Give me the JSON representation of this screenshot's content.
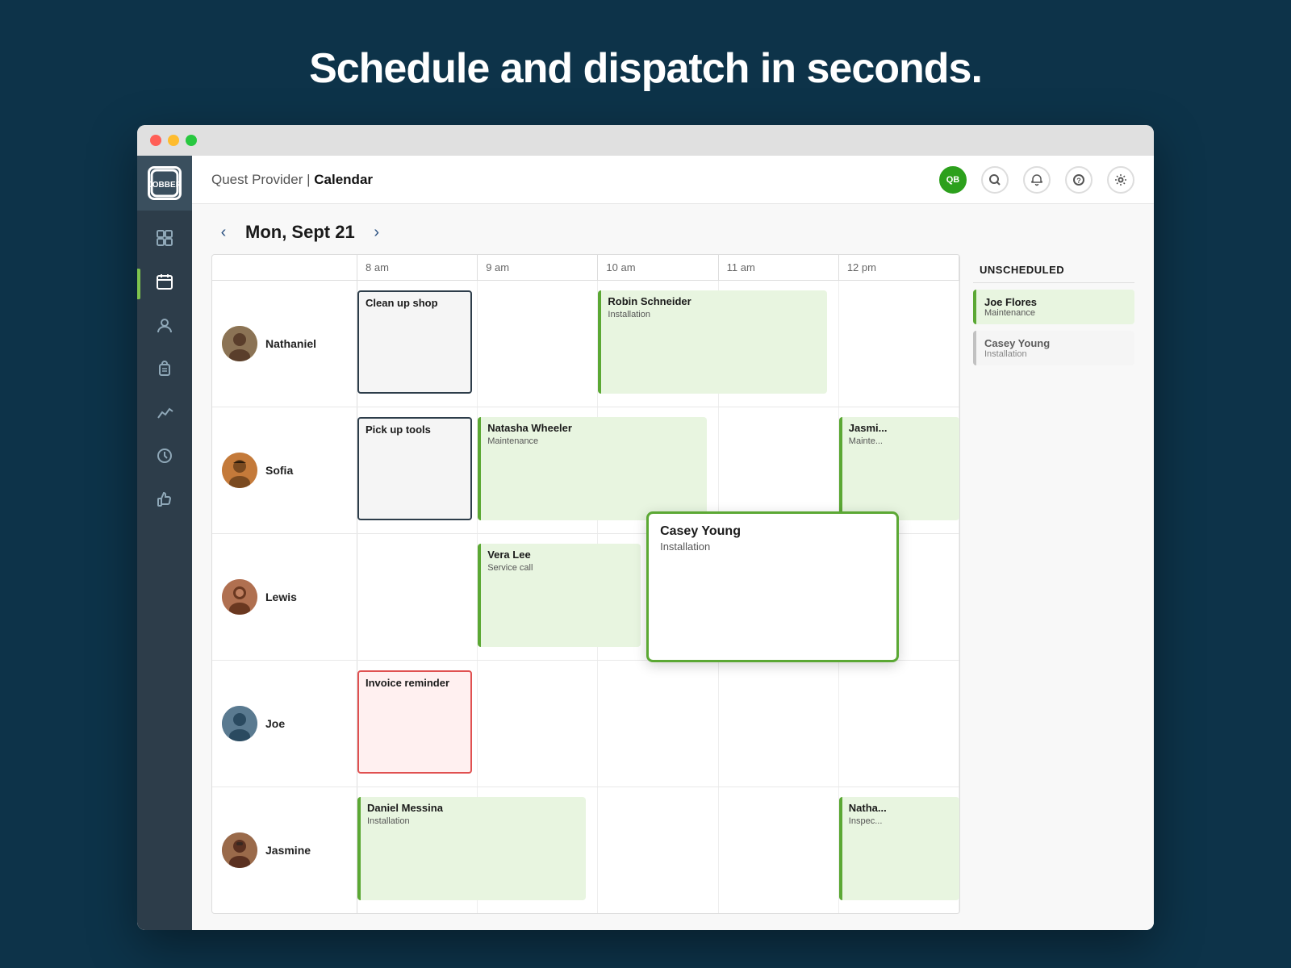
{
  "page": {
    "title": "Schedule and dispatch in seconds.",
    "bg_color": "#0d3349"
  },
  "browser": {
    "dots": [
      "red",
      "yellow",
      "green"
    ]
  },
  "topbar": {
    "provider": "Quest Provider",
    "separator": "|",
    "page": "Calendar",
    "icons": [
      "QB",
      "🔍",
      "🔔",
      "?",
      "⚙"
    ]
  },
  "sidebar": {
    "logo": "JOBBER",
    "items": [
      {
        "icon": "▦",
        "label": "dashboard",
        "active": false
      },
      {
        "icon": "📅",
        "label": "calendar",
        "active": true
      },
      {
        "icon": "👤",
        "label": "clients",
        "active": false
      },
      {
        "icon": "💼",
        "label": "jobs",
        "active": false
      },
      {
        "icon": "📊",
        "label": "reports",
        "active": false
      },
      {
        "icon": "⏱",
        "label": "time",
        "active": false
      },
      {
        "icon": "👍",
        "label": "reviews",
        "active": false
      }
    ]
  },
  "calendar": {
    "nav_prev": "‹",
    "nav_next": "›",
    "date_label": "Mon, Sept 21",
    "time_slots": [
      "8 am",
      "9 am",
      "10 am",
      "11 am",
      "12 pm"
    ],
    "people": [
      {
        "name": "Nathaniel",
        "avatar_class": "av-nathaniel",
        "events": [
          {
            "title": "Clean up shop",
            "subtitle": "",
            "style": "dark-outline",
            "col_start": 0,
            "col_span": 1,
            "top_pct": 10,
            "height_pct": 80
          }
        ]
      },
      {
        "name": "Sofia",
        "avatar_class": "av-sofia",
        "events": [
          {
            "title": "Pick up tools",
            "subtitle": "",
            "style": "dark-outline",
            "col_start": 0,
            "col_span": 1,
            "top_pct": 10,
            "height_pct": 80
          },
          {
            "title": "Natasha Wheeler",
            "subtitle": "Maintenance",
            "style": "green",
            "col_start": 1,
            "col_span": 2,
            "top_pct": 10,
            "height_pct": 80
          },
          {
            "title": "Jasmi...",
            "subtitle": "Mainte...",
            "style": "green",
            "col_start": 4,
            "col_span": 1,
            "top_pct": 10,
            "height_pct": 80
          }
        ]
      },
      {
        "name": "Lewis",
        "avatar_class": "av-lewis",
        "events": [
          {
            "title": "Vera Lee",
            "subtitle": "Service call",
            "style": "green",
            "col_start": 1,
            "col_span": 1.5,
            "top_pct": 10,
            "height_pct": 80
          },
          {
            "title": "Casey Young",
            "subtitle": "Installation",
            "style": "casey-floating",
            "col_start": 2.5,
            "col_span": 2,
            "top_pct": 5,
            "height_pct": 90
          },
          {
            "title": "",
            "subtitle": "",
            "style": "dashed-placeholder",
            "col_start": 2.5,
            "col_span": 2,
            "top_pct": 10,
            "height_pct": 80
          }
        ]
      },
      {
        "name": "Joe",
        "avatar_class": "av-joe",
        "events": [
          {
            "title": "Invoice reminder",
            "subtitle": "",
            "style": "red-outline",
            "col_start": 0,
            "col_span": 1,
            "top_pct": 10,
            "height_pct": 80
          }
        ]
      },
      {
        "name": "Jasmine",
        "avatar_class": "av-jasmine",
        "events": [
          {
            "title": "Daniel Messina",
            "subtitle": "Installation",
            "style": "green",
            "col_start": 0,
            "col_span": 2,
            "top_pct": 10,
            "height_pct": 80
          },
          {
            "title": "Natha...",
            "subtitle": "Inspec...",
            "style": "green",
            "col_start": 4,
            "col_span": 1,
            "top_pct": 10,
            "height_pct": 80
          }
        ]
      }
    ],
    "nathaniel_row": {
      "event_robin": {
        "title": "Robin Schneider",
        "subtitle": "Installation",
        "style": "green"
      }
    },
    "unscheduled": {
      "title": "UNSCHEDULED",
      "cards": [
        {
          "title": "Joe Flores",
          "subtitle": "Maintenance",
          "style": "green"
        },
        {
          "title": "Casey Young",
          "subtitle": "Installation",
          "style": "casey"
        }
      ]
    }
  }
}
